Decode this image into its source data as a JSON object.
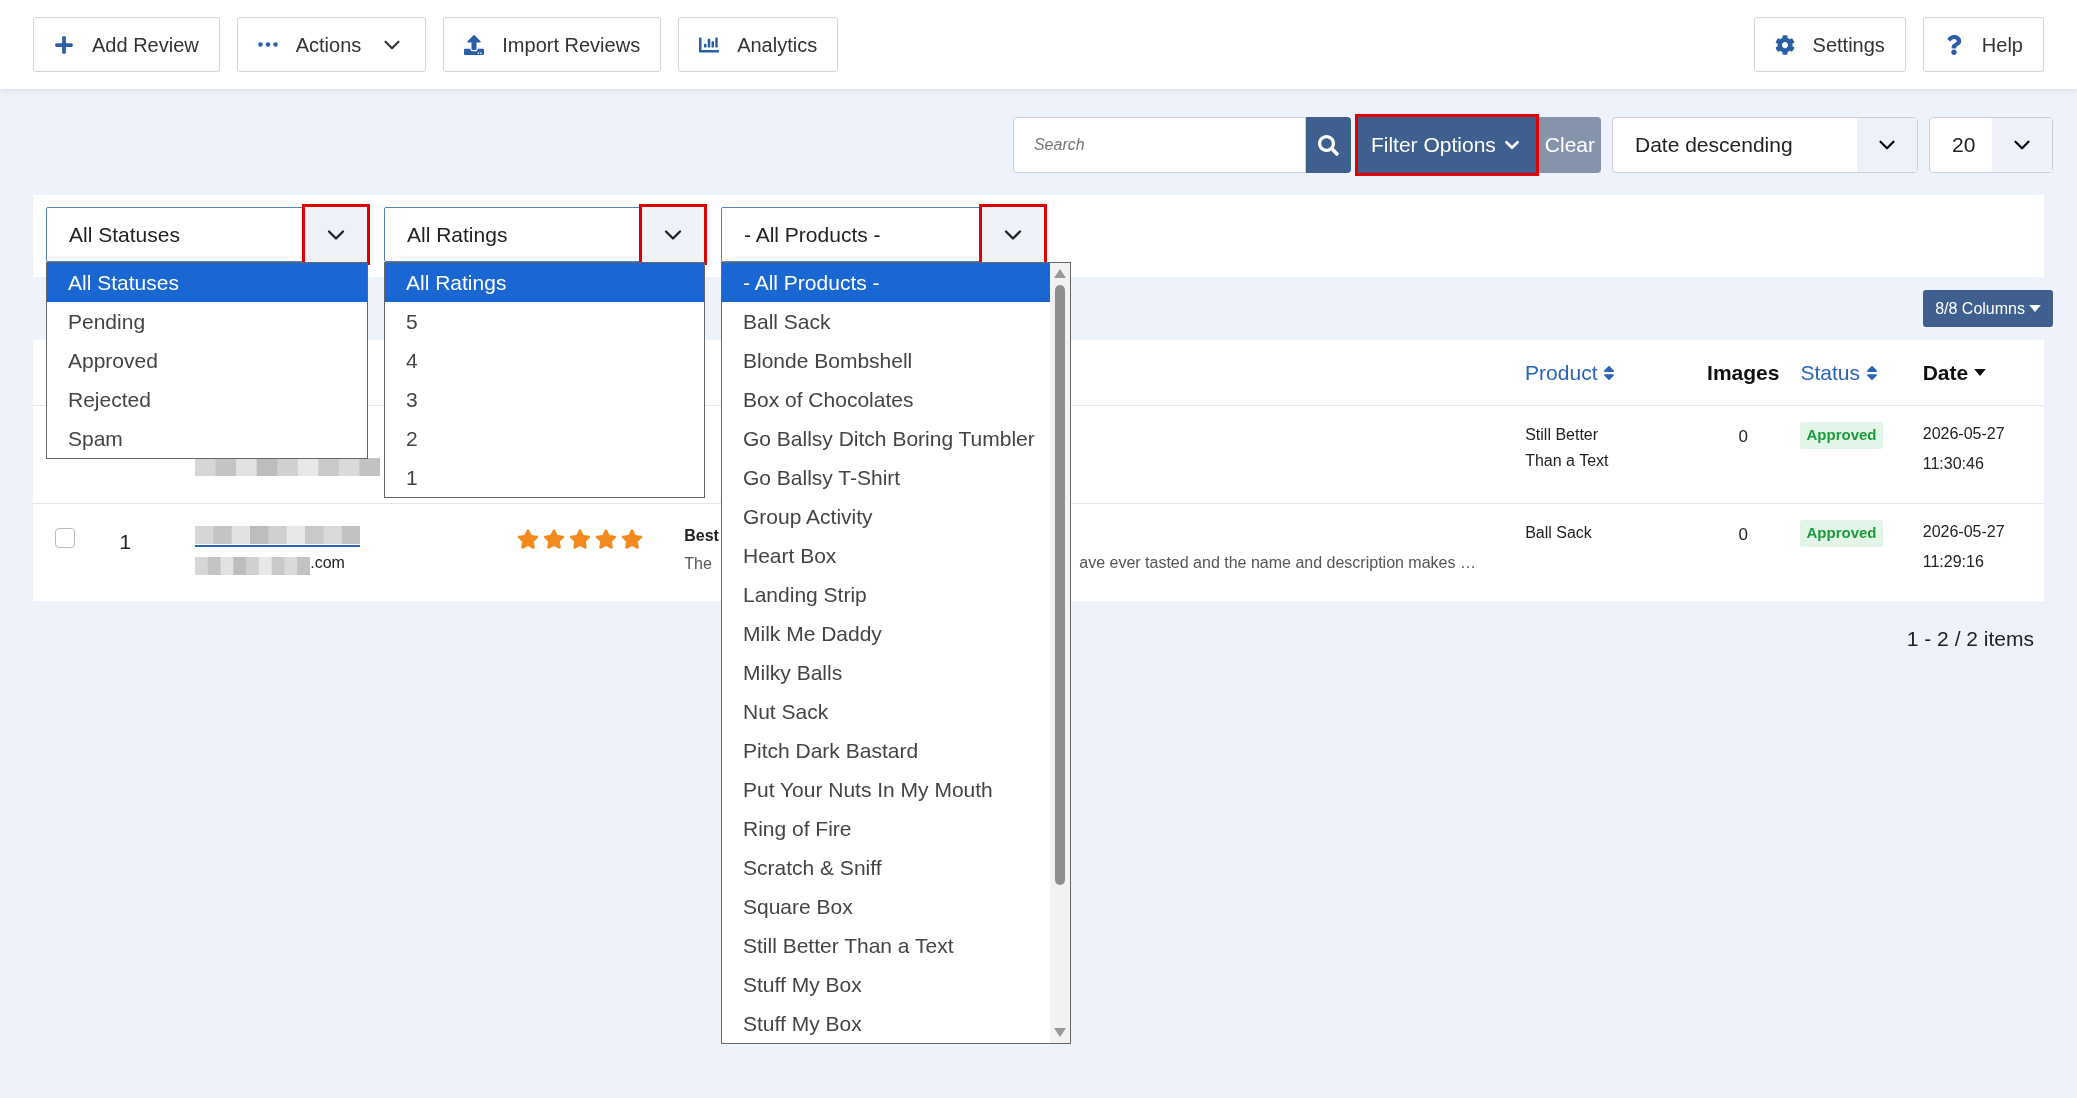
{
  "toolbar": {
    "left": [
      {
        "kind": "add",
        "label": "Add Review"
      },
      {
        "kind": "actions",
        "label": "Actions"
      },
      {
        "kind": "import",
        "label": "Import Reviews"
      },
      {
        "kind": "analytics",
        "label": "Analytics"
      }
    ],
    "right": [
      {
        "kind": "settings",
        "label": "Settings"
      },
      {
        "kind": "help",
        "label": "Help"
      }
    ]
  },
  "search": {
    "placeholder": "Search"
  },
  "filter_button": {
    "label": "Filter Options",
    "highlighted": true
  },
  "clear_button": {
    "label": "Clear"
  },
  "sort_select": {
    "value": "Date descending"
  },
  "page_size_select": {
    "value": "20"
  },
  "filters": [
    {
      "value": "All Statuses",
      "highlighted": true,
      "expanded": true,
      "options": [
        {
          "label": "All Statuses",
          "selected": true
        },
        {
          "label": "Pending",
          "selected": false
        },
        {
          "label": "Approved",
          "selected": false
        },
        {
          "label": "Rejected",
          "selected": false
        },
        {
          "label": "Spam",
          "selected": false
        }
      ]
    },
    {
      "value": "All Ratings",
      "highlighted": true,
      "expanded": true,
      "options": [
        {
          "label": "All Ratings",
          "selected": true
        },
        {
          "label": "5",
          "selected": false
        },
        {
          "label": "4",
          "selected": false
        },
        {
          "label": "3",
          "selected": false
        },
        {
          "label": "2",
          "selected": false
        },
        {
          "label": "1",
          "selected": false
        }
      ]
    },
    {
      "value": "- All Products -",
      "highlighted": true,
      "expanded": true,
      "scrollable": true,
      "options": [
        {
          "label": "- All Products -",
          "selected": true
        },
        {
          "label": "Ball Sack",
          "selected": false
        },
        {
          "label": "Blonde Bombshell",
          "selected": false
        },
        {
          "label": "Box of Chocolates",
          "selected": false
        },
        {
          "label": "Go Ballsy Ditch Boring Tumbler",
          "selected": false
        },
        {
          "label": "Go Ballsy T-Shirt",
          "selected": false
        },
        {
          "label": "Group Activity",
          "selected": false
        },
        {
          "label": "Heart Box",
          "selected": false
        },
        {
          "label": "Landing Strip",
          "selected": false
        },
        {
          "label": "Milk Me Daddy",
          "selected": false
        },
        {
          "label": "Milky Balls",
          "selected": false
        },
        {
          "label": "Nut Sack",
          "selected": false
        },
        {
          "label": "Pitch Dark Bastard",
          "selected": false
        },
        {
          "label": "Put Your Nuts In My Mouth",
          "selected": false
        },
        {
          "label": "Ring of Fire",
          "selected": false
        },
        {
          "label": "Scratch & Sniff",
          "selected": false
        },
        {
          "label": "Square Box",
          "selected": false
        },
        {
          "label": "Still Better Than a Text",
          "selected": false
        },
        {
          "label": "Stuff My Box",
          "selected": false
        },
        {
          "label": "Stuff My Box",
          "selected": false
        }
      ]
    }
  ],
  "columns_button": {
    "label": "8/8 Columns"
  },
  "table": {
    "columns": [
      {
        "label": "Product",
        "kind": "sortable"
      },
      {
        "label": "Images",
        "kind": "plain"
      },
      {
        "label": "Status",
        "kind": "sortable"
      },
      {
        "label": "Date",
        "kind": "sorted_desc"
      }
    ],
    "rows": [
      {
        "product": "Still Better Than a Text",
        "images": "0",
        "status": "Approved",
        "date": "2026-05-27",
        "time": "11:30:46"
      },
      {
        "checked": false,
        "number": "1",
        "author_suffix": ".com",
        "stars": 5,
        "review_title": "Best",
        "review_text_start": "The",
        "review_text_end": "ave ever tasted and the name and description makes …",
        "product": "Ball Sack",
        "images": "0",
        "status": "Approved",
        "date": "2026-05-27",
        "time": "11:29:16"
      }
    ]
  },
  "pagination": "1 - 2 / 2 items"
}
